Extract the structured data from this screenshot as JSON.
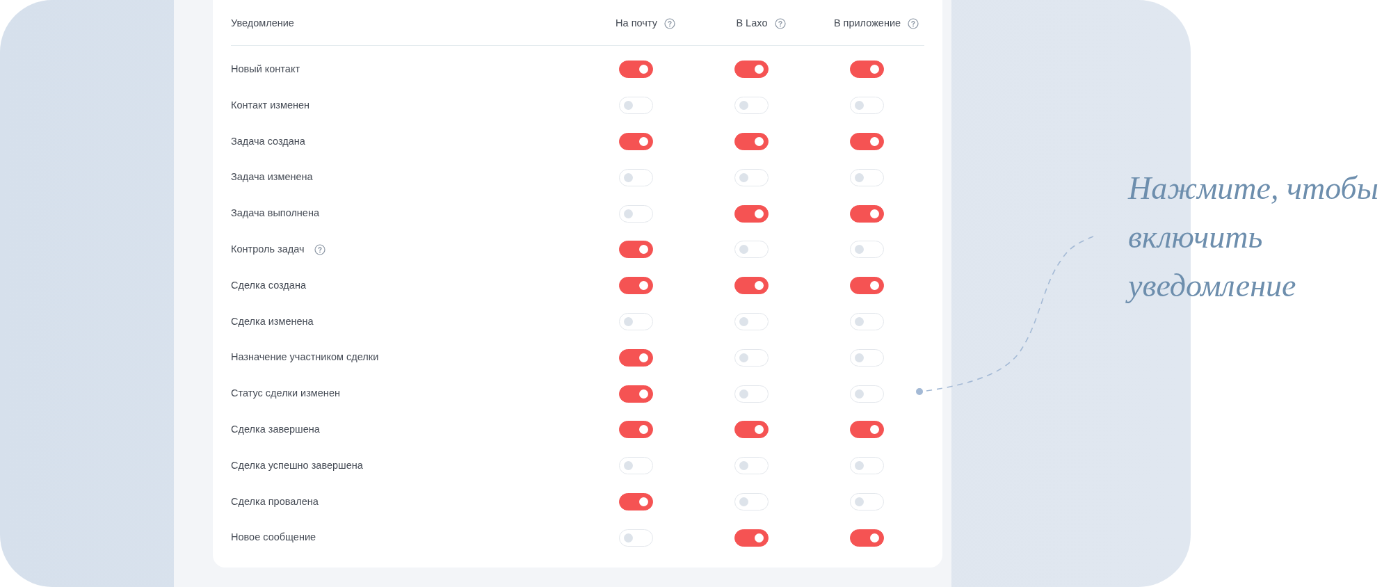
{
  "columns": [
    {
      "label": "Уведомление",
      "help": false
    },
    {
      "label": "На почту",
      "help": true
    },
    {
      "label": "В Laxo",
      "help": true
    },
    {
      "label": "В приложение",
      "help": true
    }
  ],
  "rows": [
    {
      "label": "Новый контакт",
      "help": false,
      "toggles": [
        {
          "on": true
        },
        {
          "on": true
        },
        {
          "on": true
        }
      ]
    },
    {
      "label": "Контакт изменен",
      "help": false,
      "toggles": [
        {
          "on": false
        },
        {
          "on": false
        },
        {
          "on": false
        }
      ]
    },
    {
      "label": "Задача создана",
      "help": false,
      "toggles": [
        {
          "on": true
        },
        {
          "on": true
        },
        {
          "on": true
        }
      ]
    },
    {
      "label": "Задача изменена",
      "help": false,
      "toggles": [
        {
          "on": false
        },
        {
          "on": false
        },
        {
          "on": false
        }
      ]
    },
    {
      "label": "Задача выполнена",
      "help": false,
      "toggles": [
        {
          "on": false
        },
        {
          "on": true
        },
        {
          "on": true
        }
      ]
    },
    {
      "label": "Контроль задач",
      "help": true,
      "toggles": [
        {
          "on": true
        },
        {
          "on": false
        },
        {
          "on": false
        }
      ]
    },
    {
      "label": "Сделка создана",
      "help": false,
      "toggles": [
        {
          "on": true
        },
        {
          "on": true
        },
        {
          "on": true
        }
      ]
    },
    {
      "label": "Сделка изменена",
      "help": false,
      "toggles": [
        {
          "on": false
        },
        {
          "on": false
        },
        {
          "on": false
        }
      ]
    },
    {
      "label": "Назначение участником сделки",
      "help": false,
      "toggles": [
        {
          "on": true
        },
        {
          "on": false
        },
        {
          "on": false
        }
      ]
    },
    {
      "label": "Статус сделки изменен",
      "help": false,
      "toggles": [
        {
          "on": true
        },
        {
          "on": false
        },
        {
          "on": false
        }
      ]
    },
    {
      "label": "Сделка завершена",
      "help": false,
      "toggles": [
        {
          "on": true
        },
        {
          "on": true
        },
        {
          "on": true
        }
      ]
    },
    {
      "label": "Сделка успешно завершена",
      "help": false,
      "toggles": [
        {
          "on": false
        },
        {
          "on": false
        },
        {
          "on": false
        }
      ]
    },
    {
      "label": "Сделка провалена",
      "help": false,
      "toggles": [
        {
          "on": true
        },
        {
          "on": false
        },
        {
          "on": false
        }
      ]
    },
    {
      "label": "Новое сообщение",
      "help": false,
      "toggles": [
        {
          "on": false
        },
        {
          "on": true
        },
        {
          "on": true
        }
      ]
    }
  ],
  "annotation": {
    "lines": [
      "Нажмите, чтобы",
      "включить",
      "уведомление"
    ]
  }
}
